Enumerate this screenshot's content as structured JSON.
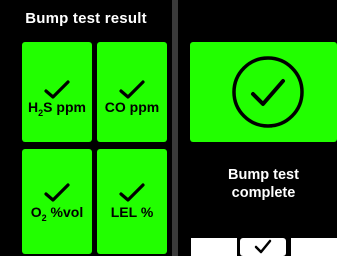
{
  "left_panel": {
    "title": "Bump test result",
    "tiles": [
      {
        "label_main": "H",
        "label_sub": "2",
        "label_rest": "S ppm",
        "status_icon": "check-icon"
      },
      {
        "label": "CO ppm",
        "status_icon": "check-icon"
      },
      {
        "label_main": "O",
        "label_sub": "2",
        "label_rest": " %vol",
        "status_icon": "check-icon"
      },
      {
        "label": "LEL %",
        "status_icon": "check-icon"
      }
    ],
    "tile_color": "#22ff00"
  },
  "right_panel": {
    "status_icon": "check-circle-icon",
    "status_text_line1": "Bump test",
    "status_text_line2": "complete",
    "status_color": "#22ff00"
  },
  "softkeys": {
    "middle_icon": "check-icon"
  }
}
